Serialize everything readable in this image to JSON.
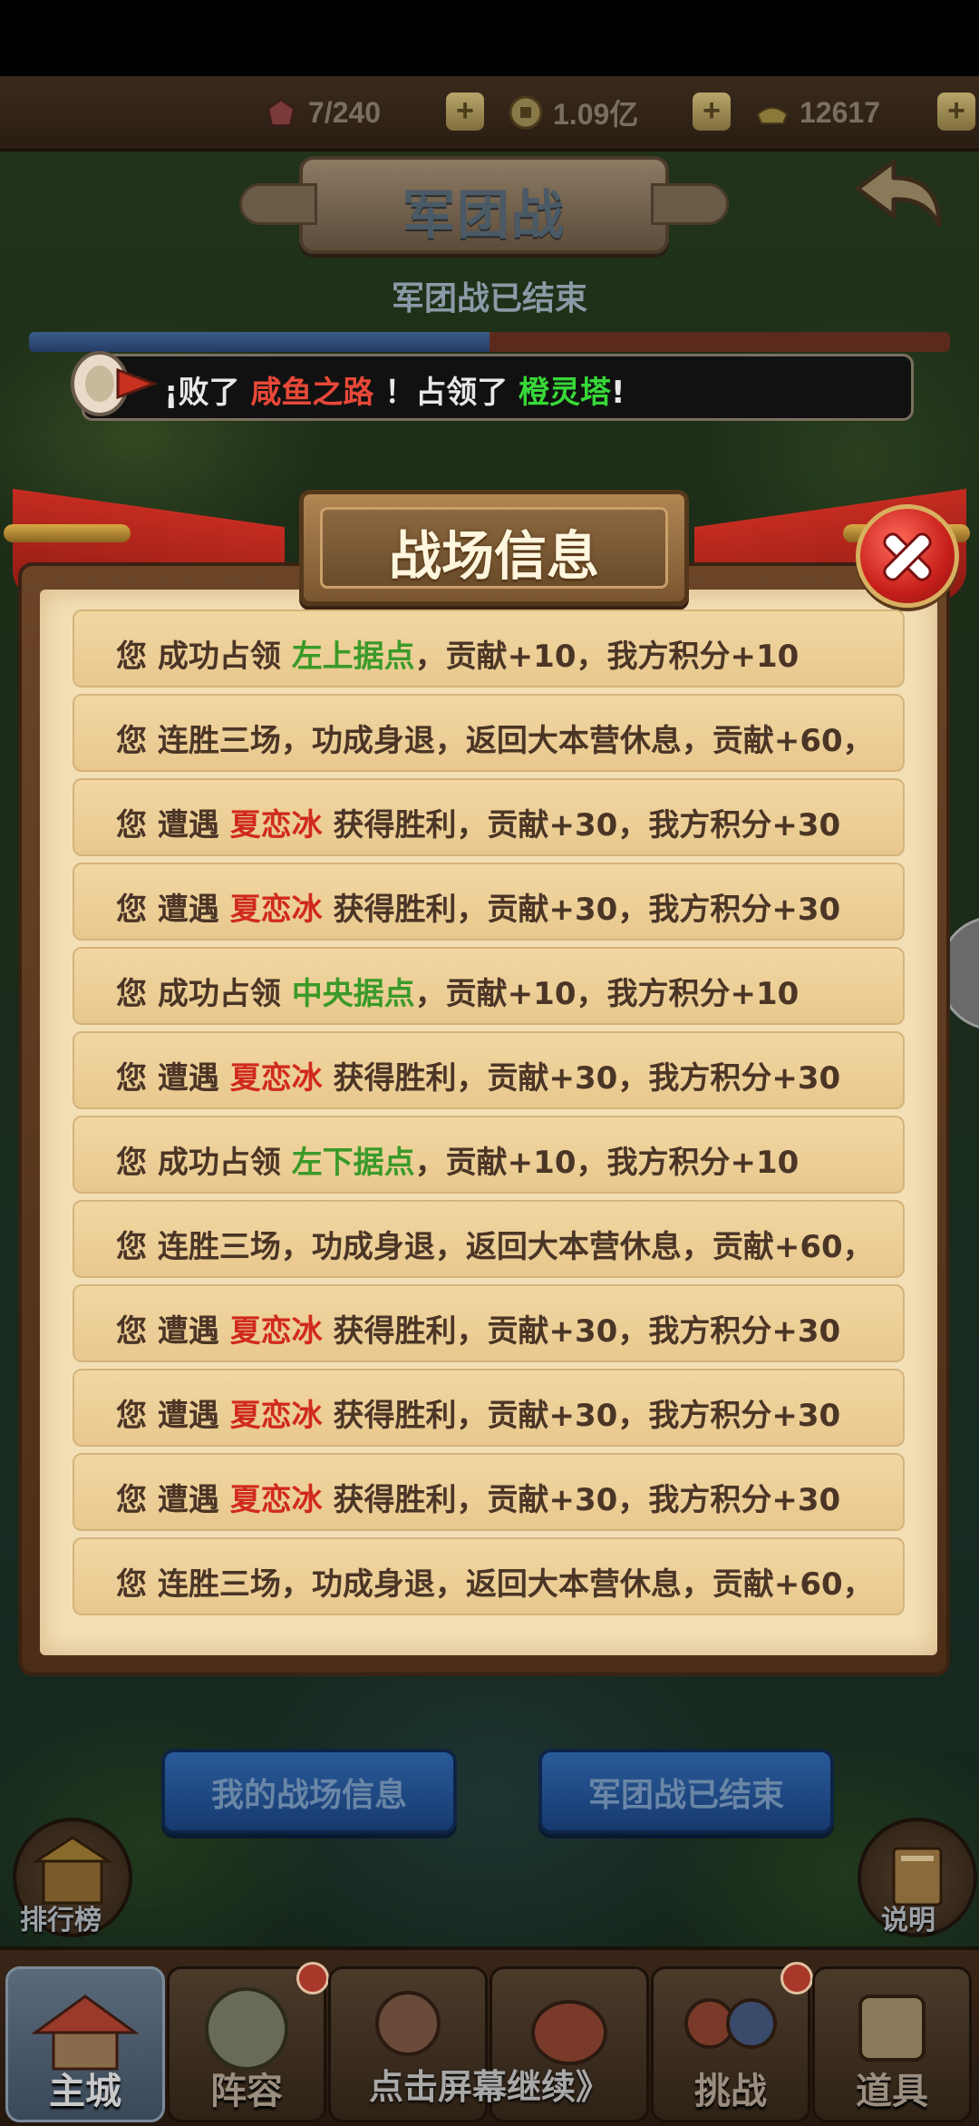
{
  "resources": {
    "stamina": "7/240",
    "coins": "1.09亿",
    "gold": "12617",
    "plus": "+"
  },
  "header": {
    "title": "军团战",
    "subtitle": "军团战已结束"
  },
  "war_progress": 0.5,
  "broadcast": {
    "prefix": "¡败了",
    "enemy": "咸鱼之路",
    "mid": "！占领了",
    "tower": "橙灵塔",
    "suffix": "!"
  },
  "panel": {
    "title": "战场信息"
  },
  "logs": [
    {
      "a": "您  成功占领 ",
      "hl": "左上据点",
      "hl_color": "green",
      "b": "，贡献+10，我方积分+10"
    },
    {
      "a": "您  连胜三场，功成身退，返回大本营休息，贡献+60，",
      "hl": "",
      "hl_color": "",
      "b": ""
    },
    {
      "a": "您  遭遇 ",
      "hl": "夏恋冰",
      "hl_color": "red",
      "b": " 获得胜利，贡献+30，我方积分+30"
    },
    {
      "a": "您  遭遇 ",
      "hl": "夏恋冰",
      "hl_color": "red",
      "b": " 获得胜利，贡献+30，我方积分+30"
    },
    {
      "a": "您  成功占领 ",
      "hl": "中央据点",
      "hl_color": "green",
      "b": "，贡献+10，我方积分+10"
    },
    {
      "a": "您  遭遇 ",
      "hl": "夏恋冰",
      "hl_color": "red",
      "b": " 获得胜利，贡献+30，我方积分+30"
    },
    {
      "a": "您  成功占领 ",
      "hl": "左下据点",
      "hl_color": "green",
      "b": "，贡献+10，我方积分+10"
    },
    {
      "a": "您  连胜三场，功成身退，返回大本营休息，贡献+60，",
      "hl": "",
      "hl_color": "",
      "b": ""
    },
    {
      "a": "您  遭遇 ",
      "hl": "夏恋冰",
      "hl_color": "red",
      "b": " 获得胜利，贡献+30，我方积分+30"
    },
    {
      "a": "您  遭遇 ",
      "hl": "夏恋冰",
      "hl_color": "red",
      "b": " 获得胜利，贡献+30，我方积分+30"
    },
    {
      "a": "您  遭遇 ",
      "hl": "夏恋冰",
      "hl_color": "red",
      "b": " 获得胜利，贡献+30，我方积分+30"
    },
    {
      "a": "您  连胜三场，功成身退，返回大本营休息，贡献+60，",
      "hl": "",
      "hl_color": "",
      "b": ""
    }
  ],
  "buttons": {
    "my_info": "我的战场信息",
    "ended": "军团战已结束",
    "ranking": "排行榜",
    "help": "说明"
  },
  "nav": {
    "items": [
      "主城",
      "阵容",
      "",
      "",
      "挑战",
      "道具"
    ],
    "continue_hint": "点击屏幕继续》"
  },
  "colors": {
    "accent_red": "#d02a1c",
    "accent_green": "#3a9a28"
  }
}
